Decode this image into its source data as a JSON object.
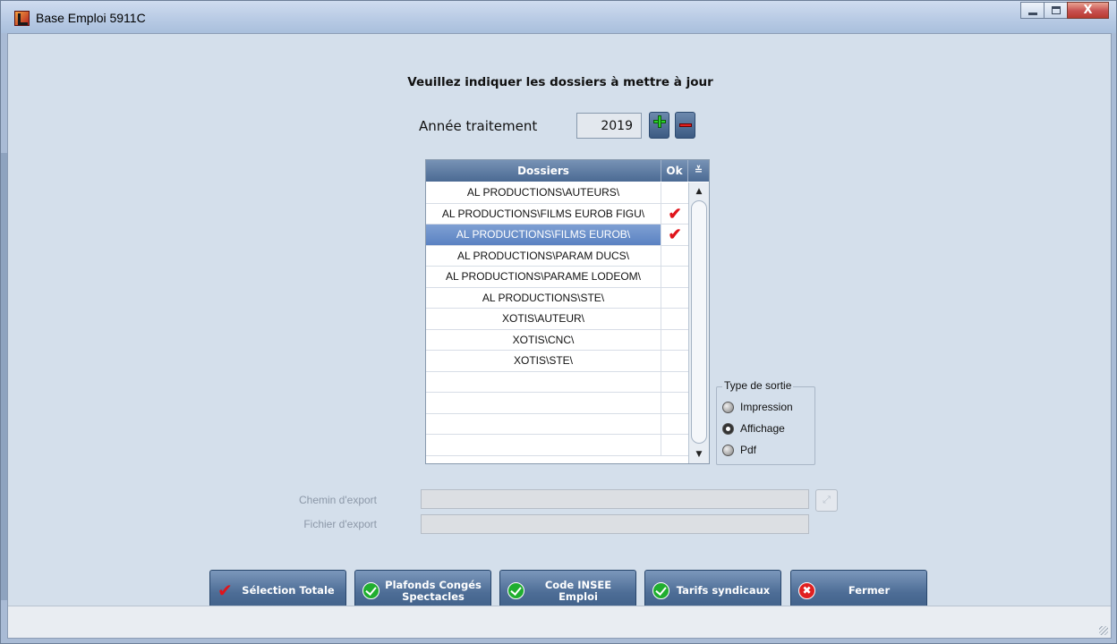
{
  "window": {
    "title": "Base Emploi 5911C",
    "close_label": "X"
  },
  "heading": "Veuillez indiquer les dossiers à mettre à jour",
  "year": {
    "label": "Année traitement",
    "value": "2019"
  },
  "grid": {
    "columns": {
      "dossiers": "Dossiers",
      "ok": "Ok",
      "menu": "≚"
    },
    "rows": [
      {
        "name": "AL PRODUCTIONS\\AUTEURS\\",
        "ok": ""
      },
      {
        "name": "AL PRODUCTIONS\\FILMS EUROB FIGU\\",
        "ok": "✔"
      },
      {
        "name": "AL PRODUCTIONS\\FILMS EUROB\\",
        "ok": "✔"
      },
      {
        "name": "AL PRODUCTIONS\\PARAM DUCS\\",
        "ok": ""
      },
      {
        "name": "AL PRODUCTIONS\\PARAME LODEOM\\",
        "ok": ""
      },
      {
        "name": "AL PRODUCTIONS\\STE\\",
        "ok": ""
      },
      {
        "name": "XOTIS\\AUTEUR\\",
        "ok": ""
      },
      {
        "name": "XOTIS\\CNC\\",
        "ok": ""
      },
      {
        "name": "XOTIS\\STE\\",
        "ok": ""
      },
      {
        "name": "",
        "ok": ""
      },
      {
        "name": "",
        "ok": ""
      },
      {
        "name": "",
        "ok": ""
      },
      {
        "name": "",
        "ok": ""
      }
    ],
    "selected_row": 2,
    "scroll_up": "▲",
    "scroll_down": "▼"
  },
  "output_type": {
    "legend": "Type de sortie",
    "options": [
      "Impression",
      "Affichage",
      "Pdf"
    ],
    "selected": "Affichage"
  },
  "export": {
    "path_label": "Chemin d'export",
    "file_label": "Fichier d'export",
    "path_value": "",
    "file_value": ""
  },
  "buttons": {
    "select_all": "Sélection Totale",
    "plafonds_line1": "Plafonds Congés",
    "plafonds_line2": "Spectacles",
    "insee_line1": "Code INSEE",
    "insee_line2": "Emploi",
    "tarifs": "Tarifs syndicaux",
    "close": "Fermer"
  },
  "icons": {
    "select_all": "red-check-icon",
    "plafonds": "green-check-icon",
    "insee": "green-check-icon",
    "tarifs": "green-check-icon",
    "close": "red-x-icon",
    "add_year": "plus-icon",
    "remove_year": "minus-icon",
    "browse": "browse-icon"
  },
  "colors": {
    "window_bg": "#d4dfeb",
    "button_bg": "#4d6d96",
    "grid_header": "#5b799f",
    "selected_row": "#6a8fca",
    "check_mark": "#e0141b"
  }
}
